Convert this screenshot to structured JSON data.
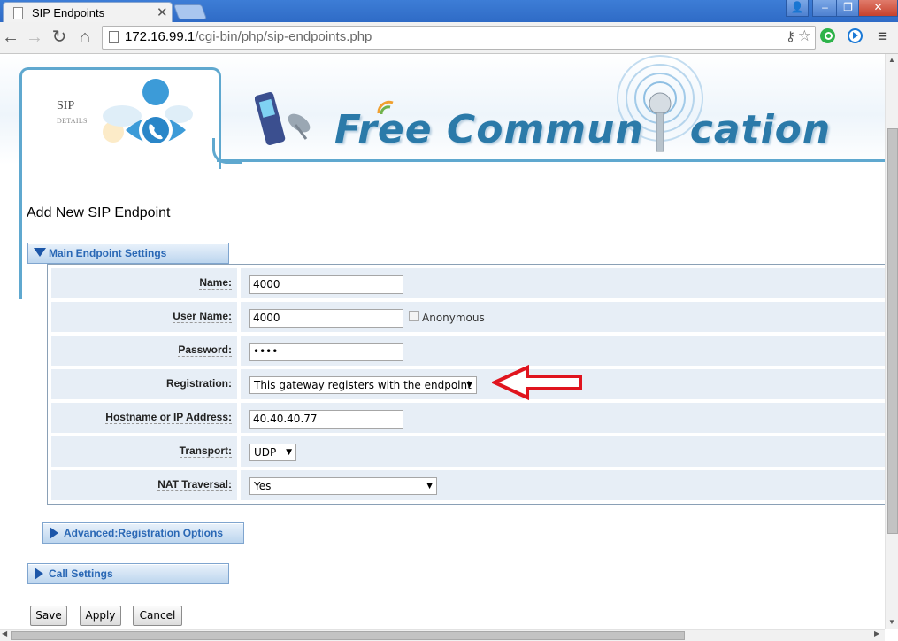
{
  "browser": {
    "tab_title": "SIP Endpoints",
    "tab_close": "✕",
    "url_host": "172.16.99.1",
    "url_path": "/cgi-bin/php/sip-endpoints.php",
    "window_controls": {
      "user": "👤",
      "minimize": "–",
      "maximize": "❐",
      "close": "✕"
    },
    "nav": {
      "back": "←",
      "forward": "→",
      "reload": "↻",
      "home": "⌂"
    },
    "menu": "≡"
  },
  "banner": {
    "logo_title": "SIP",
    "logo_subtitle": "DETAILS",
    "brand_left": "Free Commun",
    "brand_right": "cation"
  },
  "page": {
    "title": "Add New SIP Endpoint"
  },
  "sections": {
    "main": "Main Endpoint Settings",
    "advanced": "Advanced:Registration Options",
    "call": "Call Settings"
  },
  "form": {
    "name": {
      "label": "Name:",
      "value": "4000"
    },
    "username": {
      "label": "User Name:",
      "value": "4000",
      "anonymous_label": "Anonymous"
    },
    "password": {
      "label": "Password:",
      "value": "••••"
    },
    "registration": {
      "label": "Registration:",
      "value": "This gateway registers with the endpoint"
    },
    "hostname": {
      "label": "Hostname or IP Address:",
      "value": "40.40.40.77"
    },
    "transport": {
      "label": "Transport:",
      "value": "UDP"
    },
    "nat": {
      "label": "NAT Traversal:",
      "value": "Yes"
    }
  },
  "buttons": {
    "save": "Save",
    "apply": "Apply",
    "cancel": "Cancel"
  },
  "colors": {
    "accent": "#5fa8cf",
    "section_text": "#2a68b5",
    "annotation_arrow": "#e0141e"
  }
}
